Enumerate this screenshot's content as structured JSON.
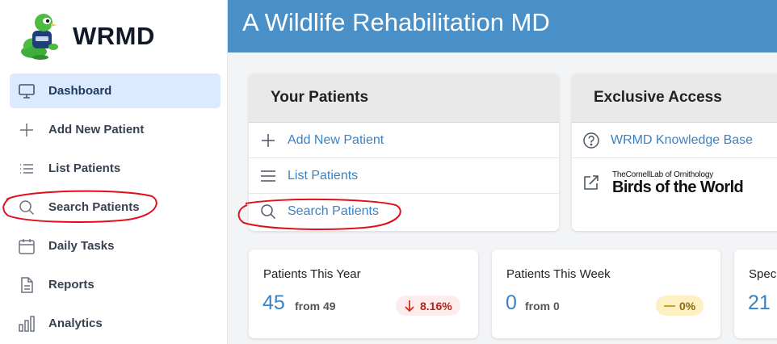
{
  "brand": {
    "name": "WRMD",
    "logo_icon": "wrmd-mascot-logo"
  },
  "sidebar": {
    "items": [
      {
        "label": "Dashboard",
        "icon": "monitor-icon",
        "active": true
      },
      {
        "label": "Add New Patient",
        "icon": "plus-icon"
      },
      {
        "label": "List Patients",
        "icon": "list-icon"
      },
      {
        "label": "Search Patients",
        "icon": "search-icon"
      },
      {
        "label": "Daily Tasks",
        "icon": "calendar-icon"
      },
      {
        "label": "Reports",
        "icon": "document-icon"
      },
      {
        "label": "Analytics",
        "icon": "bar-chart-icon"
      }
    ]
  },
  "header": {
    "title": "A Wildlife Rehabilitation MD"
  },
  "your_patients": {
    "title": "Your Patients",
    "links": [
      {
        "label": "Add New Patient",
        "icon": "plus-icon"
      },
      {
        "label": "List Patients",
        "icon": "menu-icon"
      },
      {
        "label": "Search Patients",
        "icon": "search-icon"
      }
    ]
  },
  "exclusive_access": {
    "title": "Exclusive Access",
    "knowledge_base": "WRMD Knowledge Base",
    "cornell_top": "TheCornellLab of Ornithology",
    "cornell_bottom": "Birds of the World"
  },
  "stats": [
    {
      "title": "Patients This Year",
      "value": "45",
      "from": "from 49",
      "change": "8.16%",
      "trend": "down"
    },
    {
      "title": "Patients This Week",
      "value": "0",
      "from": "from 0",
      "change": "0%",
      "trend": "flat"
    },
    {
      "title": "Spec",
      "value": "21"
    }
  ],
  "colors": {
    "accent": "#4a90c8",
    "link": "#3b82c4",
    "active_bg": "#dbeafe",
    "annotation": "#e0101a"
  }
}
